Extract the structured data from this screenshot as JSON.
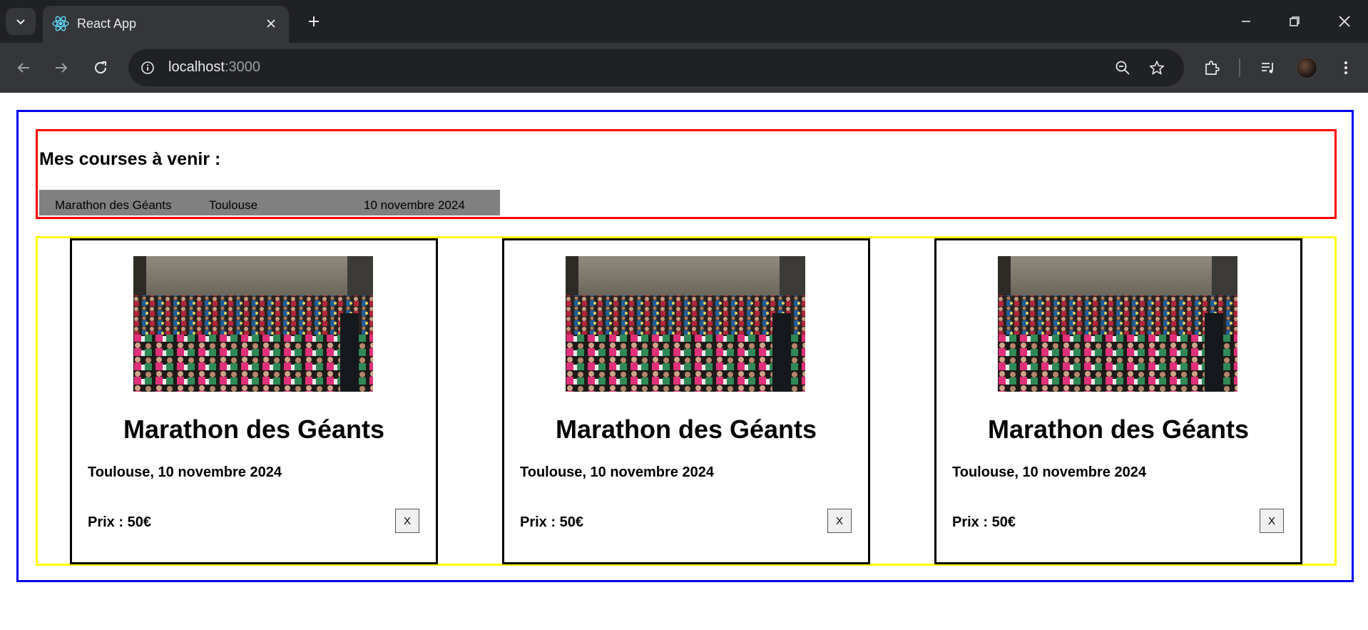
{
  "browser": {
    "tab": {
      "title": "React App",
      "favicon": "react-logo-icon"
    },
    "address": {
      "host": "localhost",
      "port": ":3000"
    },
    "icons": {
      "tab_search": "chevron-down-icon",
      "new_tab": "plus-icon",
      "back": "arrow-left-icon",
      "forward": "arrow-right-icon",
      "reload": "reload-icon",
      "site_info": "info-icon",
      "zoom": "zoom-out-icon",
      "bookmark": "star-icon",
      "extensions": "puzzle-icon",
      "media": "media-control-icon",
      "menu": "more-vertical-icon"
    },
    "colors": {
      "tabbar": "#202124",
      "toolbar": "#35363a",
      "omnibox": "#202124",
      "text": "#e8eaed"
    }
  },
  "upcoming": {
    "title": "Mes courses à venir :",
    "rows": [
      {
        "name": "Marathon des Géants",
        "city": "Toulouse",
        "date": "10 novembre 2024"
      }
    ]
  },
  "cards": [
    {
      "title": "Marathon des Géants",
      "location": "Toulouse, 10 novembre 2024",
      "price": "Prix : 50€",
      "remove_label": "X"
    },
    {
      "title": "Marathon des Géants",
      "location": "Toulouse, 10 novembre 2024",
      "price": "Prix : 50€",
      "remove_label": "X"
    },
    {
      "title": "Marathon des Géants",
      "location": "Toulouse, 10 novembre 2024",
      "price": "Prix : 50€",
      "remove_label": "X"
    }
  ],
  "colors": {
    "app_border": "#0000ee",
    "upcoming_border": "#ff0000",
    "cards_border": "#ffff00",
    "row_background": "#808080"
  }
}
